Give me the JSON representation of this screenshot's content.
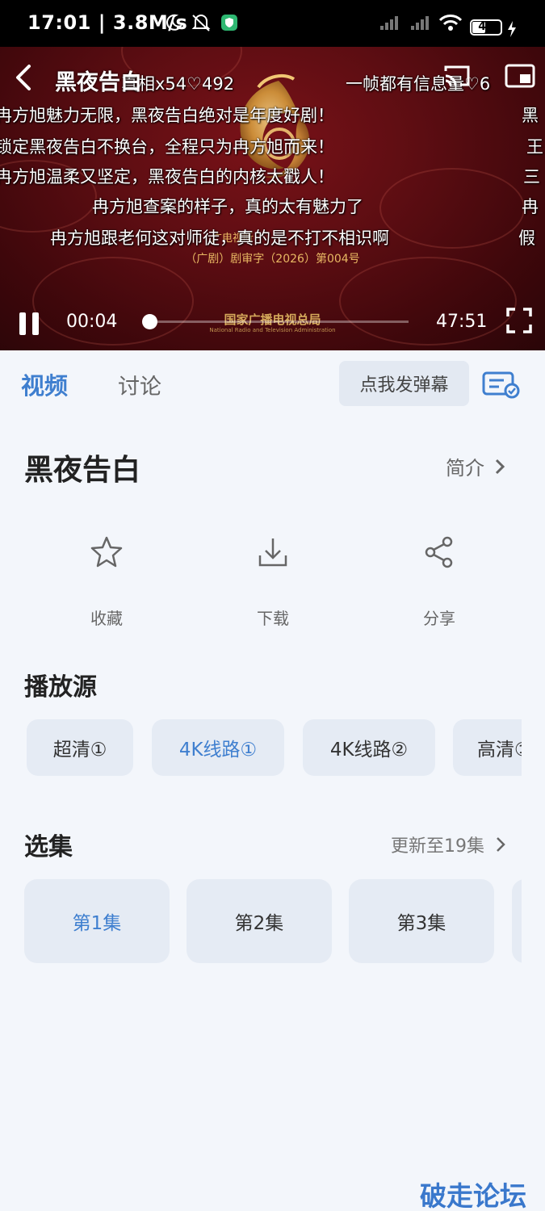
{
  "status_bar": {
    "time": "17:01",
    "network_speed": "3.8M/s",
    "battery": "46",
    "battery_level": 0.46
  },
  "player": {
    "title": "黑夜告白",
    "current_time": "00:04",
    "total_time": "47:51",
    "progress": 0.0014,
    "license_line1": "广电视听",
    "license_line2": "（广剧）剧审字（2026）第004号",
    "bureau_cn": "国家广播电视总局",
    "bureau_en": "National Radio and Television Administration",
    "danmaku": [
      "真相x54♡492",
      "一帧都有信息量♡6",
      "冉方旭魅力无限，黑夜告白绝对是年度好剧！",
      "锁定黑夜告白不换台，全程只为冉方旭而来！",
      "冉方旭温柔又坚定，黑夜告白的内核太戳人！",
      "冉方旭查案的样子，真的太有魅力了",
      "冉方旭跟老何这对师徒，真的是不打不相识啊",
      "黑",
      "王",
      "三",
      "冉",
      "假"
    ]
  },
  "tabs": {
    "video": "视频",
    "discuss": "讨论",
    "send_danmaku": "点我发弹幕"
  },
  "show": {
    "title": "黑夜告白",
    "intro": "简介"
  },
  "actions": {
    "favorite": "收藏",
    "download": "下载",
    "share": "分享"
  },
  "source": {
    "title": "播放源",
    "options": [
      "超清①",
      "4K线路①",
      "4K线路②",
      "高清①"
    ],
    "selected": "4K线路①"
  },
  "episodes": {
    "title": "选集",
    "update": "更新至19集",
    "items": [
      "第1集",
      "第2集",
      "第3集"
    ],
    "selected": "第1集"
  },
  "watermark": "破走论坛",
  "colors": {
    "accent": "#3f7fcf",
    "chip_bg": "#e5ebf4",
    "page_bg": "#f3f6fb",
    "player_red": "#5c0d12",
    "gold": "#e8b863"
  }
}
